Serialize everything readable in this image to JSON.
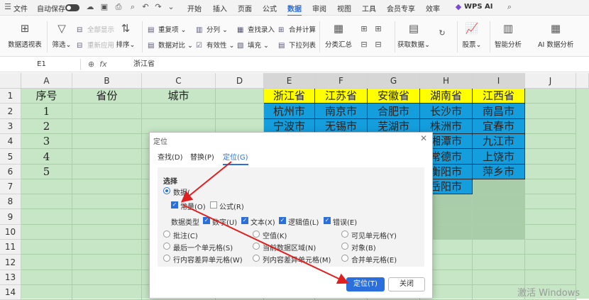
{
  "menubar": {
    "file": "文件",
    "autosave": "自动保存",
    "tabs": [
      "开始",
      "插入",
      "页面",
      "公式",
      "数据",
      "审阅",
      "视图",
      "工具",
      "会员专享",
      "效率"
    ],
    "active_tab": "数据",
    "wps_ai": "WPS AI"
  },
  "ribbon": {
    "pivot": "数据透视表",
    "filter": "筛选",
    "show_all": "全部显示",
    "reapply": "重新应用",
    "sort": "排序",
    "duplicates": "重复项",
    "compare": "数据对比",
    "split": "分列",
    "validity": "有效性",
    "find_entry": "查找录入",
    "fill": "填充",
    "merge_calc": "合并计算",
    "dropdown": "下拉列表",
    "subtotal": "分类汇总",
    "get_data": "获取数据",
    "stocks": "股票",
    "smart": "智能分析",
    "ai_analysis": "AI 数据分析"
  },
  "formula_bar": {
    "cell_ref": "E1",
    "fx": "fx",
    "content": "浙江省"
  },
  "sheet": {
    "columns": [
      "A",
      "B",
      "C",
      "D",
      "E",
      "F",
      "G",
      "H",
      "I",
      "J"
    ],
    "rows": [
      "1",
      "2",
      "3",
      "4",
      "5",
      "6",
      "7",
      "8",
      "9",
      "10",
      "11",
      "12",
      "13",
      "14"
    ],
    "headers": [
      "序号",
      "省份",
      "城市"
    ],
    "serials": [
      "1",
      "2",
      "3",
      "4",
      "5"
    ],
    "provinces": [
      "浙江省",
      "江苏省",
      "安徽省",
      "湖南省",
      "江西省"
    ],
    "cities": {
      "r2": [
        "杭州市",
        "南京市",
        "合肥市",
        "长沙市",
        "南昌市"
      ],
      "r3": [
        "宁波市",
        "无锡市",
        "芜湖市",
        "株洲市",
        "宜春市"
      ],
      "r4": [
        "",
        "",
        "",
        "湘潭市",
        "九江市"
      ],
      "r5": [
        "",
        "",
        "",
        "常德市",
        "上饶市"
      ],
      "r6": [
        "",
        "",
        "",
        "衡阳市",
        "萍乡市"
      ],
      "r7": [
        "岳阳市"
      ]
    }
  },
  "dialog": {
    "title": "定位",
    "tabs": [
      "查找(D)",
      "替换(P)",
      "定位(G)"
    ],
    "section": "选择",
    "data_label": "数据(",
    "constants": "常量(O)",
    "formulas": "公式(R)",
    "data_types_label": "数据类型",
    "types": [
      "数字(U)",
      "文本(X)",
      "逻辑值(L)",
      "错误(E)"
    ],
    "opt_comments": "批注(C)",
    "opt_blanks": "空值(K)",
    "opt_visible": "可见单元格(Y)",
    "opt_last_cell": "最后一个单元格(S)",
    "opt_current_region": "当前数据区域(N)",
    "opt_objects": "对象(B)",
    "opt_row_diff": "行内容差异单元格(W)",
    "opt_col_diff": "列内容差异单元格(M)",
    "opt_merged": "合并单元格(E)",
    "ok": "定位(T)",
    "close": "关闭"
  },
  "watermark": "激活 Windows",
  "colors": {
    "accent": "#2a6fdb",
    "sheet_green": "#c6e6c6",
    "province_yellow": "#ffff00",
    "city_blue": "#149ede",
    "arrow_red": "#e02020"
  }
}
